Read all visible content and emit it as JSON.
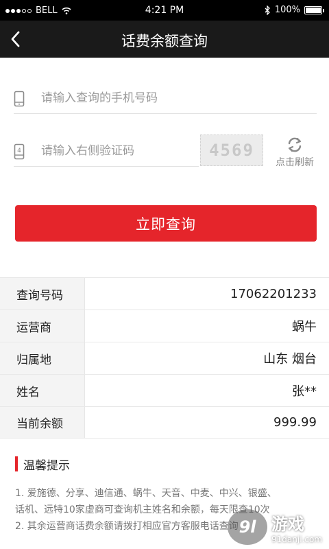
{
  "status_bar": {
    "carrier": "BELL",
    "time": "4:21 PM",
    "battery": "100%",
    "signal_icon": "signal-dots-icon",
    "wifi_icon": "wifi-icon",
    "bluetooth_icon": "bluetooth-icon",
    "battery_level": 1.0
  },
  "nav": {
    "title": "话费余额查询",
    "back_icon": "chevron-left-icon"
  },
  "form": {
    "phone_placeholder": "请输入查询的手机号码",
    "captcha_placeholder": "请输入右侧验证码",
    "captcha_code": "4569",
    "refresh_label": "点击刷新",
    "submit_label": "立即查询"
  },
  "result": {
    "rows": [
      {
        "label": "查询号码",
        "value": "17062201233"
      },
      {
        "label": "运营商",
        "value": "蜗牛"
      },
      {
        "label": "归属地",
        "value": "山东 烟台"
      },
      {
        "label": "姓名",
        "value": "张**"
      },
      {
        "label": "当前余额",
        "value": "999.99"
      }
    ]
  },
  "tips": {
    "title": "温馨提示",
    "lines": [
      "1. 爱施德、分享、迪信通、蜗牛、天音、中麦、中兴、银盛、",
      "话机、远特10家虚商可查询机主姓名和余额，每天限查10次",
      "2. 其余运营商话费余额请拨打相应官方客服电话查询"
    ]
  },
  "watermark": {
    "logo": "9l",
    "name": "游戏",
    "url": "91danji.com"
  },
  "colors": {
    "accent": "#e5252b",
    "navbar": "#1a1a1a",
    "label_bg": "#f4f4f4"
  }
}
